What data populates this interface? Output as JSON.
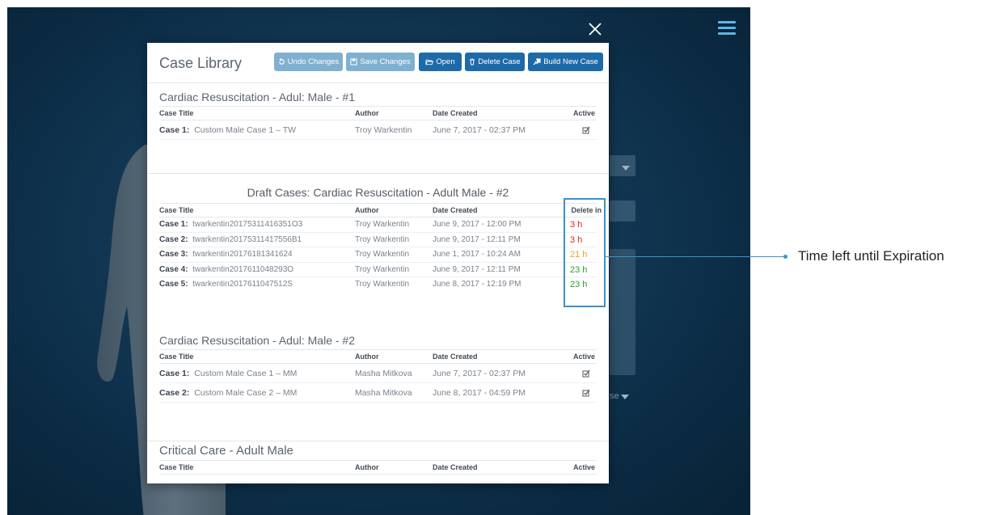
{
  "modal": {
    "title": "Case Library",
    "buttons": {
      "undo": "Undo Changes",
      "save": "Save Changes",
      "open": "Open",
      "delete": "Delete Case",
      "build": "Build New Case"
    }
  },
  "columns": {
    "case_title": "Case Title",
    "author": "Author",
    "date_created": "Date Created",
    "active": "Active",
    "delete_in": "Delete in"
  },
  "sections": [
    {
      "title": "Cardiac Resuscitation - Adul: Male - #1",
      "rows": [
        {
          "num": "Case 1:",
          "title": "Custom Male Case 1 – TW",
          "author": "Troy Warkentin",
          "date": "June 7, 2017 - 02:37 PM",
          "active": true
        }
      ]
    },
    {
      "title": "Draft Cases: Cardiac Resuscitation - Adult Male - #2",
      "rows": [
        {
          "num": "Case 1:",
          "title": "twarkentin20175311416351O3",
          "author": "Troy Warkentin",
          "date": "June 9, 2017 - 12:00 PM",
          "delete_in": "3 h",
          "status": "red"
        },
        {
          "num": "Case 2:",
          "title": "twarkentin20175311417556B1",
          "author": "Troy Warkentin",
          "date": "June 9, 2017 - 12:11 PM",
          "delete_in": "3 h",
          "status": "red"
        },
        {
          "num": "Case 3:",
          "title": "twarkentin20176181341624",
          "author": "Troy Warkentin",
          "date": "June 1, 2017 - 10:24 AM",
          "delete_in": "21 h",
          "status": "orange"
        },
        {
          "num": "Case 4:",
          "title": "twarkentin2017611048293O",
          "author": "Troy Warkentin",
          "date": "June 9, 2017 - 12:11 PM",
          "delete_in": "23 h",
          "status": "green"
        },
        {
          "num": "Case 5:",
          "title": "twarkentin2017611047512S",
          "author": "Troy Warkentin",
          "date": "June 8, 2017 - 12:19 PM",
          "delete_in": "23 h",
          "status": "green"
        }
      ]
    },
    {
      "title": "Cardiac Resuscitation - Adul: Male - #2",
      "rows": [
        {
          "num": "Case 1:",
          "title": "Custom Male Case 1 – MM",
          "author": "Masha Mitkova",
          "date": "June 7, 2017 - 02:37 PM",
          "active": true
        },
        {
          "num": "Case 2:",
          "title": "Custom Male Case 2 – MM",
          "author": "Masha Mitkova",
          "date": "June 8, 2017 - 04:59 PM",
          "active": true
        }
      ]
    },
    {
      "title": "Critical Care - Adult Male",
      "rows": []
    }
  ],
  "background": {
    "partial_text": "se"
  },
  "annotation": {
    "label": "Time left until Expiration"
  },
  "colors": {
    "accent": "#3a92cc",
    "btn_primary": "#1d6aa8",
    "btn_muted": "#7fb0d0",
    "red": "#e02222",
    "orange": "#f0a11a",
    "green": "#2e9e2e"
  },
  "icons": {
    "menu": "hamburger-icon",
    "close": "close-icon",
    "undo": "undo-icon",
    "save": "save-icon",
    "open": "folder-open-icon",
    "delete": "trash-icon",
    "build": "build-icon",
    "active": "checked-box-icon"
  }
}
